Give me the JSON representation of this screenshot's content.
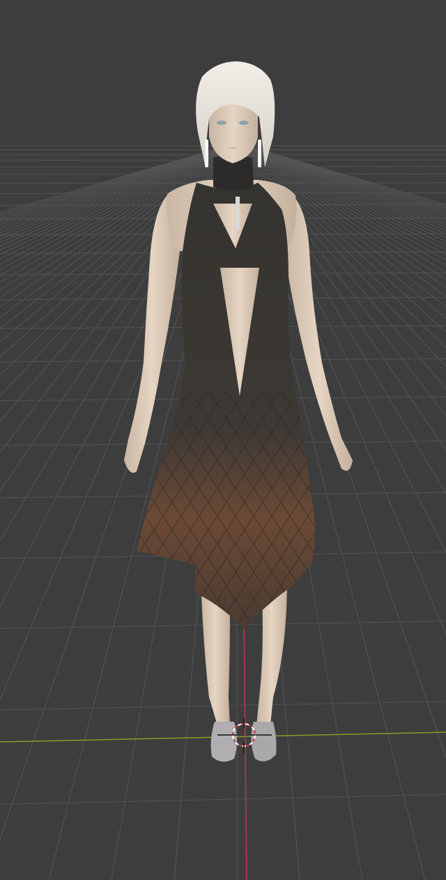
{
  "viewport": {
    "view": "perspective",
    "background_color": "#3d3d3d",
    "grid_color": "#555555",
    "x_axis_color": "#8a9a2a",
    "z_axis_color": "#c0394b",
    "grid_visible": true,
    "cursor_3d": "3d-cursor-icon"
  },
  "scene_object": {
    "type": "character-model",
    "hair_color": "#e8e4dc",
    "skin_color": "#e3d0bd",
    "dress_color": "#3a3836",
    "dress_accent_color": "#6e4630",
    "shoe_color": "#b0aeb0"
  }
}
